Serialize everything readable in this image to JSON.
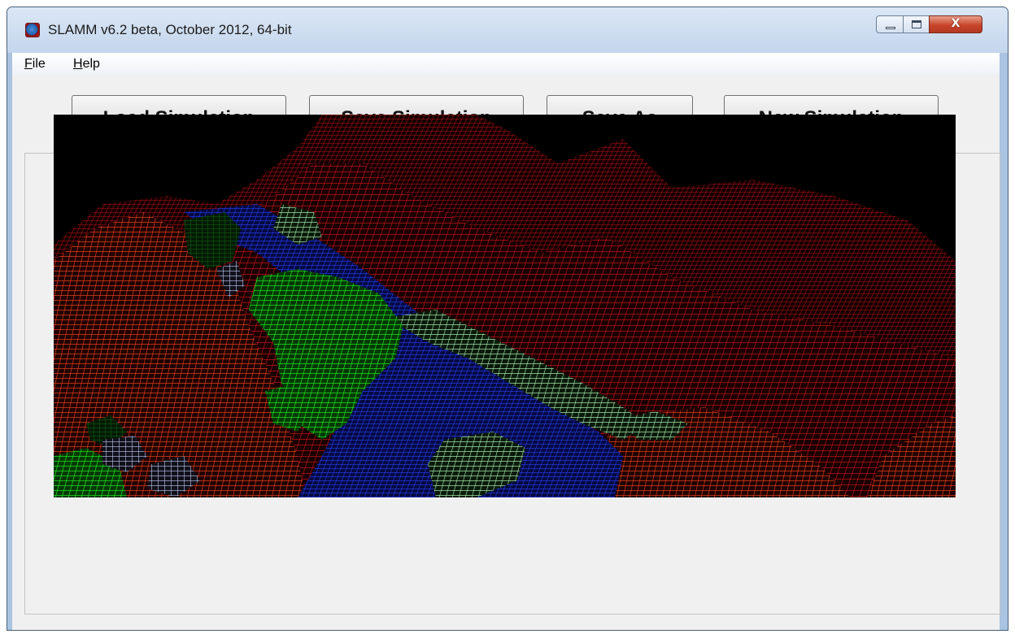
{
  "window": {
    "title": "SLAMM v6.2 beta, October 2012, 64-bit",
    "icon": "globe-icon",
    "controls": {
      "minimize": "minimize-icon",
      "maximize": "maximize-icon",
      "close": "close-icon",
      "close_glyph": "X"
    }
  },
  "menu": {
    "items": [
      {
        "label": "File",
        "accel": "F",
        "rest": "ile"
      },
      {
        "label": "Help",
        "accel": "H",
        "rest": "elp"
      }
    ]
  },
  "toolbar": {
    "load": {
      "accel": "L",
      "rest": "oad Simulation"
    },
    "save_label": "Save Simulation",
    "save_as_label": "Save As",
    "new_label": "New Simulation"
  },
  "viewport": {
    "description_colors": {
      "background": "#000000",
      "upland_red": "#c0141e",
      "upland_orange": "#e8401e",
      "water_blue": "#1c2ad6",
      "marsh_green": "#1ee01e",
      "dark_marsh": "#0a4a0a",
      "tidal_flat_pale": "#a8e8b0"
    }
  }
}
